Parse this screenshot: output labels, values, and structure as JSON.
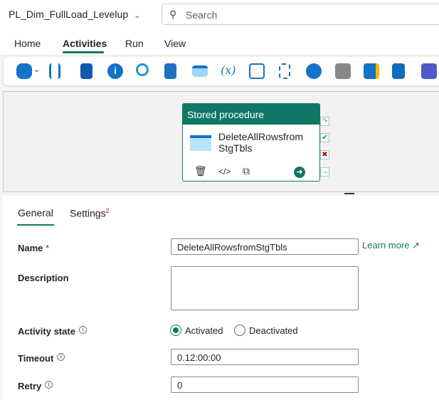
{
  "header": {
    "pipeline_name": "PL_Dim_FullLoad_Levelup",
    "search_placeholder": "Search"
  },
  "menu": {
    "tabs": [
      "Home",
      "Activities",
      "Run",
      "View"
    ],
    "active": "Activities"
  },
  "toolbar": {
    "icons": [
      "copy-data-icon",
      "dataflow-icon",
      "notebook-icon",
      "get-metadata-icon",
      "lookup-icon",
      "script-icon",
      "stored-procedure-icon",
      "set-variable-icon",
      "if-condition-icon",
      "switch-icon",
      "web-icon",
      "azure-function-icon",
      "azure-batch-icon",
      "outlook-icon",
      "teams-icon"
    ]
  },
  "activity_card": {
    "type": "Stored procedure",
    "name": "DeleteAllRowsfrom StgTbls",
    "name_line1": "DeleteAllRowsfrom",
    "name_line2": "StgTbls"
  },
  "panel": {
    "tabs": {
      "general": "General",
      "settings": "Settings",
      "settings_badge": "2"
    },
    "name_label": "Name",
    "required_mark": "*",
    "name_value": "DeleteAllRowsfromStgTbls",
    "learn_more": "Learn more",
    "description_label": "Description",
    "description_value": "",
    "activity_state_label": "Activity state",
    "activated": "Activated",
    "deactivated": "Deactivated",
    "timeout_label": "Timeout",
    "timeout_value": "0.12:00:00",
    "retry_label": "Retry",
    "retry_value": "0"
  },
  "colors": {
    "accent": "#117865"
  }
}
